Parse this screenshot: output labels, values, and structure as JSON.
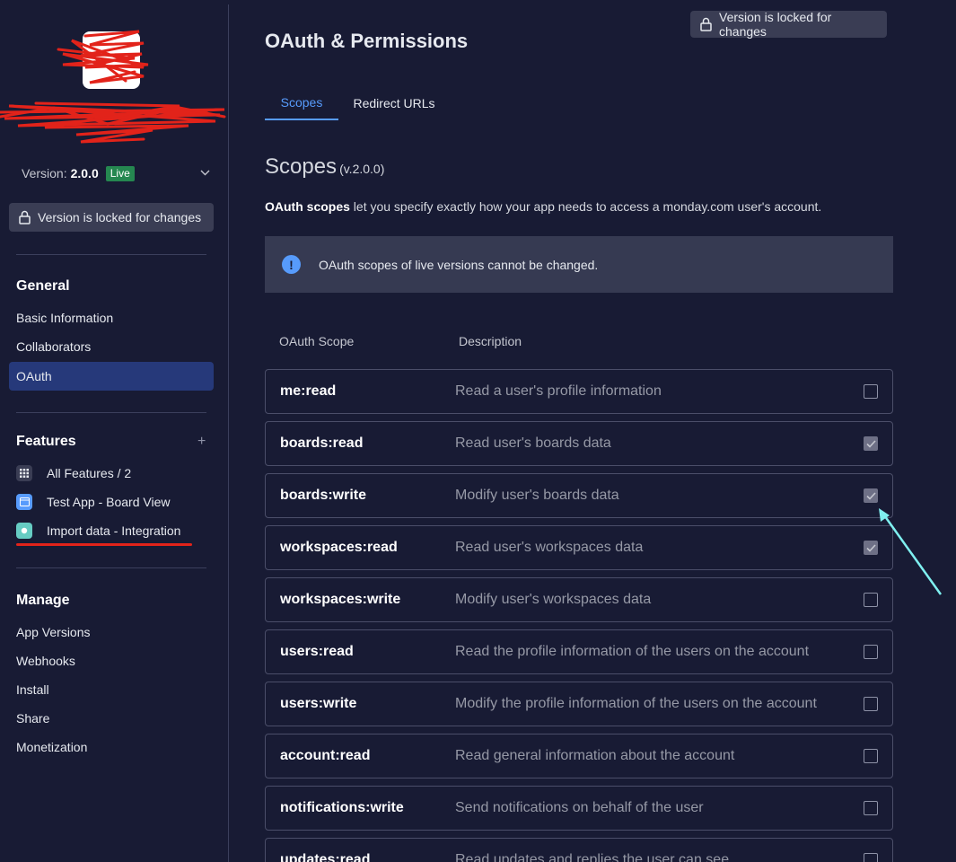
{
  "sidebar": {
    "version_label": "Version:",
    "version_number": "2.0.0",
    "live_badge": "Live",
    "lock_text": "Version is locked for changes",
    "general": {
      "title": "General",
      "items": [
        {
          "label": "Basic Information",
          "active": false
        },
        {
          "label": "Collaborators",
          "active": false
        },
        {
          "label": "OAuth",
          "active": true
        }
      ]
    },
    "features": {
      "title": "Features",
      "items": [
        {
          "label": "All Features / 2",
          "icon": "grid-icon",
          "color": "#3a3d54"
        },
        {
          "label": "Test App - Board View",
          "icon": "board-view-icon",
          "color": "#579bfc"
        },
        {
          "label": "Import data - Integration",
          "icon": "integration-icon",
          "color": "#66ccc3"
        }
      ]
    },
    "manage": {
      "title": "Manage",
      "items": [
        "App Versions",
        "Webhooks",
        "Install",
        "Share",
        "Monetization"
      ]
    }
  },
  "header": {
    "title": "OAuth & Permissions",
    "lock_text": "Version is locked for changes"
  },
  "tabs": [
    {
      "label": "Scopes",
      "active": true
    },
    {
      "label": "Redirect URLs",
      "active": false
    }
  ],
  "scopes": {
    "heading": "Scopes",
    "version": "(v.2.0.0)",
    "intro_bold": "OAuth scopes",
    "intro_rest": " let you specify exactly how your app needs to access a monday.com user's account.",
    "alert_text": "OAuth scopes of live versions cannot be changed.",
    "col_scope": "OAuth Scope",
    "col_desc": "Description",
    "rows": [
      {
        "scope": "me:read",
        "desc": "Read a user's profile information",
        "checked": false
      },
      {
        "scope": "boards:read",
        "desc": "Read user's boards data",
        "checked": true
      },
      {
        "scope": "boards:write",
        "desc": "Modify user's boards data",
        "checked": true
      },
      {
        "scope": "workspaces:read",
        "desc": "Read user's workspaces data",
        "checked": true
      },
      {
        "scope": "workspaces:write",
        "desc": "Modify user's workspaces data",
        "checked": false
      },
      {
        "scope": "users:read",
        "desc": "Read the profile information of the users on the account",
        "checked": false
      },
      {
        "scope": "users:write",
        "desc": "Modify the profile information of the users on the account",
        "checked": false
      },
      {
        "scope": "account:read",
        "desc": "Read general information about the account",
        "checked": false
      },
      {
        "scope": "notifications:write",
        "desc": "Send notifications on behalf of the user",
        "checked": false
      },
      {
        "scope": "updates:read",
        "desc": "Read updates and replies the user can see",
        "checked": false
      }
    ]
  },
  "colors": {
    "background": "#181b34",
    "accent": "#579bfc",
    "live": "#258750",
    "annotation_red": "#e2231a",
    "annotation_arrow": "#7ff0f0"
  }
}
